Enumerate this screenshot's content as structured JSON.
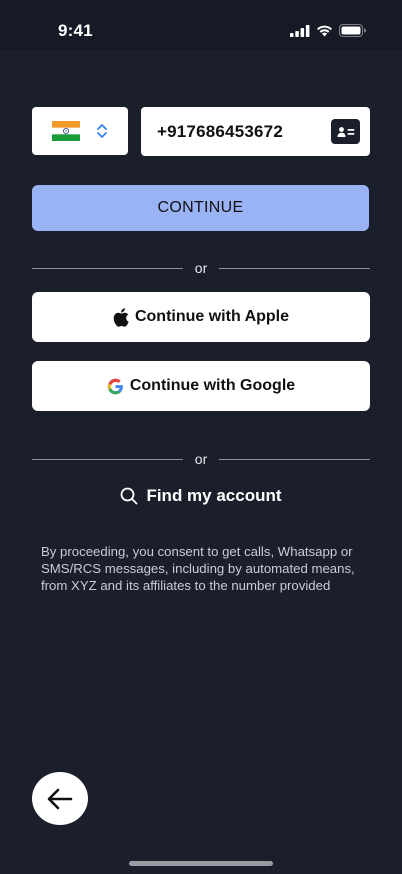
{
  "status_bar": {
    "time": "9:41"
  },
  "country": {
    "flag": "🇮🇳",
    "icon": "chevron-up-down-icon"
  },
  "phone": {
    "value": "+917686453672",
    "contact_icon": "contact-card-icon"
  },
  "continue": {
    "label": "CONTINUE",
    "color": "#9ab3f5"
  },
  "divider": {
    "text": "or"
  },
  "apple": {
    "label": "Continue with Apple"
  },
  "google": {
    "label": "Continue with Google"
  },
  "find_account": {
    "label": "Find my account"
  },
  "consent": {
    "text": "By proceeding, you consent to get calls, Whatsapp or SMS/RCS messages, including by automated means, from XYZ and its affiliates to the number provided"
  },
  "colors": {
    "background": "#1b1f2b",
    "status_bar": "#161a24",
    "accent": "#9ab3f5"
  }
}
